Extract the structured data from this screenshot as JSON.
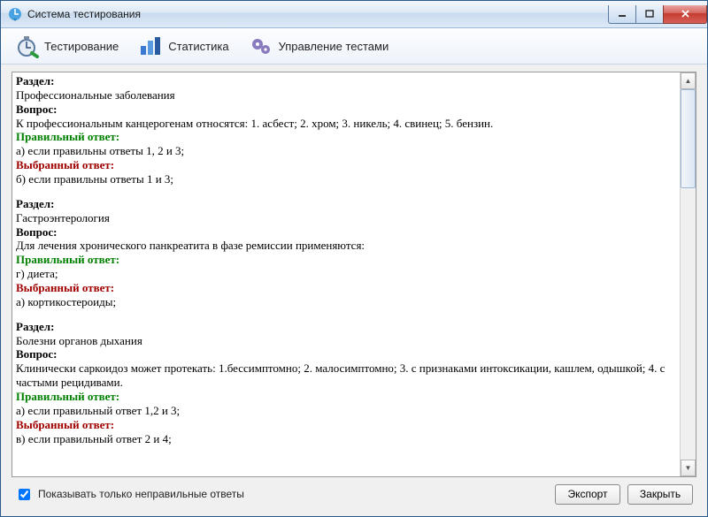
{
  "window": {
    "title": "Система тестирования"
  },
  "toolbar": {
    "testing": "Тестирование",
    "stats": "Статистика",
    "manage": "Управление тестами"
  },
  "labels": {
    "section": "Раздел:",
    "question": "Вопрос:",
    "correct": "Правильный ответ:",
    "chosen": "Выбранный ответ:"
  },
  "entries": [
    {
      "section": "Профессиональные заболевания",
      "question": "К профессиональным канцерогенам относятся: 1. асбест; 2. хром; 3. никель; 4. свинец; 5. бензин.",
      "correct": "а) если правильны ответы 1, 2 и 3;",
      "chosen": "б) если правильны ответы 1 и 3;"
    },
    {
      "section": "Гастроэнтерология",
      "question": "Для лечения хронического панкреатита в фазе ремиссии применяются:",
      "correct": "г) диета;",
      "chosen": "а) кортикостероиды;"
    },
    {
      "section": "Болезни органов дыхания",
      "question": "Клинически саркоидоз может протекать: 1.бессимптомно; 2. малосимптомно; 3. с признаками интоксикации, кашлем, одышкой; 4. с частыми рецидивами.",
      "correct": "а) если правильный ответ 1,2 и 3;",
      "chosen": "в) если правильный ответ 2 и 4;"
    }
  ],
  "footer": {
    "checkbox": "Показывать только неправильные ответы",
    "checked": true,
    "export": "Экспорт",
    "close": "Закрыть"
  }
}
